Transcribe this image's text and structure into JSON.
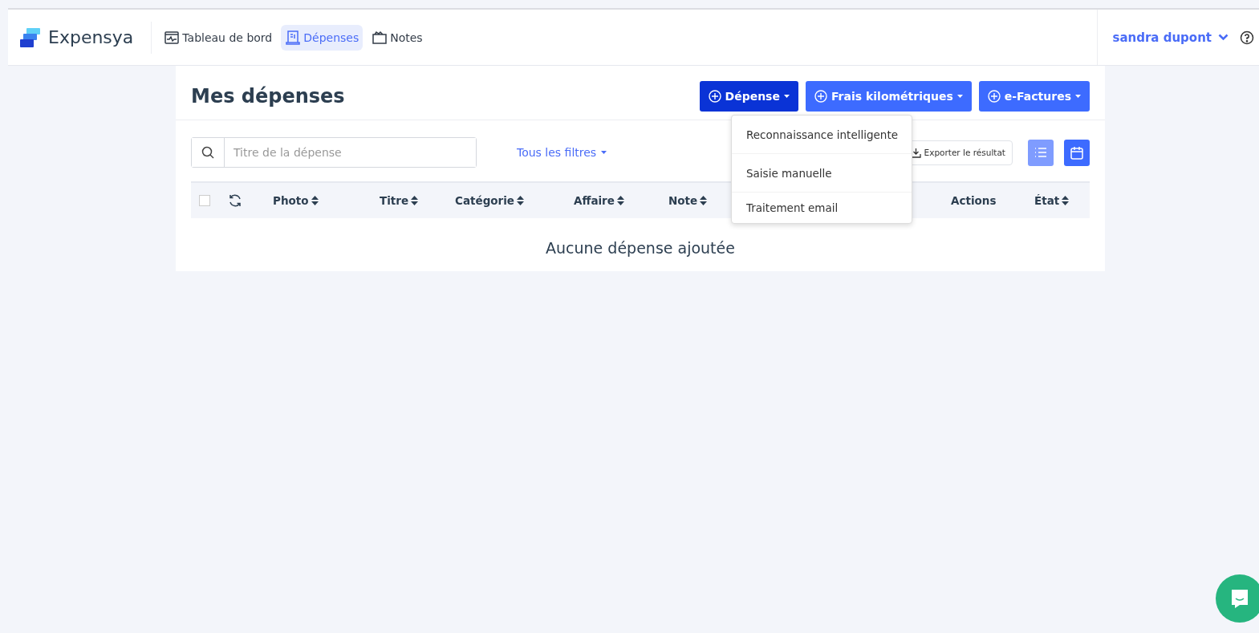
{
  "brand": {
    "name": "Expensya"
  },
  "nav": [
    {
      "label": "Tableau de bord",
      "kind": "dashboard",
      "selected": false
    },
    {
      "label": "Dépenses",
      "kind": "expenses",
      "selected": true
    },
    {
      "label": "Notes",
      "kind": "notes",
      "selected": false
    }
  ],
  "user": {
    "name": "sandra dupont"
  },
  "page": {
    "title": "Mes dépenses"
  },
  "actions": [
    {
      "label": "Dépense",
      "open": true
    },
    {
      "label": "Frais kilométriques",
      "open": false
    },
    {
      "label": "e-Factures",
      "open": false
    }
  ],
  "menu": {
    "items": [
      "Reconnaissance intelligente",
      "Saisie manuelle",
      "Traitement email"
    ]
  },
  "search": {
    "placeholder": "Titre de la dépense"
  },
  "filters": {
    "label": "Tous les filtres"
  },
  "export": {
    "label": "Exporter le résultat"
  },
  "views": [
    {
      "kind": "list",
      "selected": true
    },
    {
      "kind": "calendar",
      "selected": false
    }
  ],
  "table": {
    "select_all": {
      "checked": false
    },
    "columns": [
      {
        "label": "Photo",
        "sortable": true
      },
      {
        "label": "Titre",
        "sortable": true
      },
      {
        "label": "Catégorie",
        "sortable": true
      },
      {
        "label": "Affaire",
        "sortable": true
      },
      {
        "label": "Note",
        "sortable": true
      },
      {
        "label": "Actions",
        "sortable": false
      },
      {
        "label": "État",
        "sortable": true
      }
    ],
    "empty": "Aucune dépense ajoutée"
  }
}
